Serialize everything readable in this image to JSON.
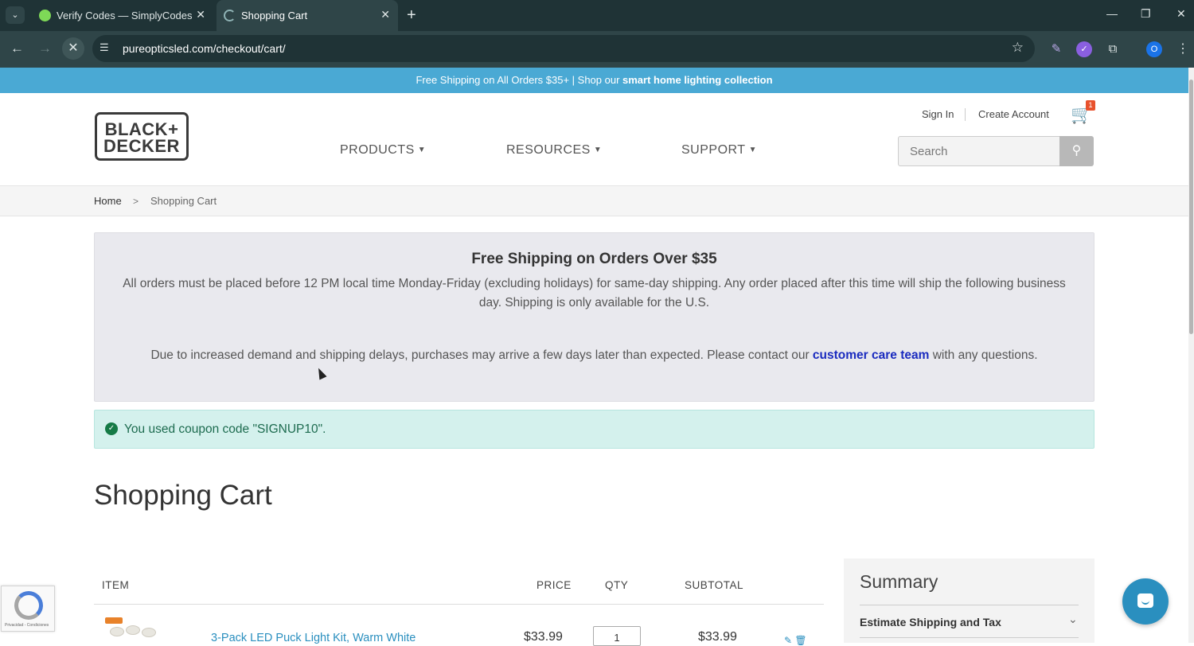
{
  "browser": {
    "tabs": [
      {
        "title": "Verify Codes — SimplyCodes"
      },
      {
        "title": "Shopping Cart"
      }
    ],
    "url": "pureopticsled.com/checkout/cart/",
    "profile_initial": "O"
  },
  "promo": {
    "text": "Free Shipping on All Orders $35+ | Shop our ",
    "link": "smart home lighting collection"
  },
  "header": {
    "logo_line1": "BLACK+",
    "logo_line2": "DECKER",
    "sign_in": "Sign In",
    "create_account": "Create Account",
    "cart_count": "1",
    "nav": [
      "PRODUCTS",
      "RESOURCES",
      "SUPPORT"
    ],
    "search_placeholder": "Search"
  },
  "breadcrumb": {
    "home": "Home",
    "current": "Shopping Cart"
  },
  "notice": {
    "title": "Free Shipping on Orders Over $35",
    "p1": "All orders must be placed before 12 PM local time Monday-Friday (excluding holidays) for same-day shipping. Any order placed after this time will ship the following business day. Shipping is only available for the U.S.",
    "p2_before": "Due to increased demand and shipping delays, purchases may arrive a few days later than expected. Please contact our ",
    "p2_link": "customer care team",
    "p2_after": " with any questions."
  },
  "coupon": {
    "message": "You used coupon code \"SIGNUP10\"."
  },
  "page_title": "Shopping Cart",
  "cart": {
    "columns": [
      "ITEM",
      "PRICE",
      "QTY",
      "SUBTOTAL"
    ],
    "items": [
      {
        "name": "3-Pack LED Puck Light Kit, Warm White",
        "price": "$33.99",
        "qty": "1",
        "subtotal": "$33.99"
      }
    ]
  },
  "summary": {
    "title": "Summary",
    "estimate": "Estimate Shipping and Tax"
  },
  "recaptcha": {
    "text": "Privacidad - Condiciones"
  },
  "colors": {
    "promo_bar": "#4aa9d4",
    "coupon_bg": "#d4f1ed",
    "link": "#2a8fbf",
    "browser_chrome": "#1f3336"
  }
}
